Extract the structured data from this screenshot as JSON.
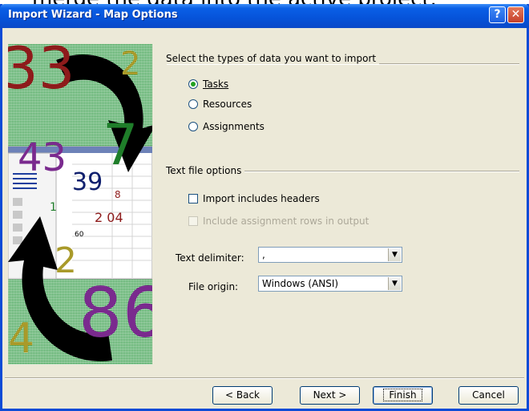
{
  "background_text": "merge the data into the active project.",
  "window": {
    "title": "Import Wizard - Map Options",
    "help_label": "?",
    "close_label": "✕"
  },
  "import_types": {
    "group_label": "Select the types of data you want to import",
    "options": [
      {
        "label": "Tasks",
        "selected": true
      },
      {
        "label": "Resources",
        "selected": false
      },
      {
        "label": "Assignments",
        "selected": false
      }
    ]
  },
  "text_file_options": {
    "group_label": "Text file options",
    "import_headers_label": "Import includes headers",
    "import_headers_checked": false,
    "include_assignment_rows_label": "Include assignment rows in output",
    "include_assignment_rows_enabled": false,
    "text_delimiter_label": "Text delimiter:",
    "text_delimiter_value": ",",
    "file_origin_label": "File origin:",
    "file_origin_value": "Windows (ANSI)"
  },
  "art": {
    "numbers": [
      "33",
      "2",
      "7",
      "43",
      "39",
      "8",
      "1",
      "2 04",
      "60",
      "2",
      "86",
      "4"
    ]
  },
  "buttons": {
    "back": "< Back",
    "next": "Next >",
    "finish": "Finish",
    "cancel": "Cancel"
  },
  "colors": {
    "title_blue": "#0a5fe6",
    "dialog_bg": "#ece9d8",
    "art_green": "#2f9a43"
  }
}
